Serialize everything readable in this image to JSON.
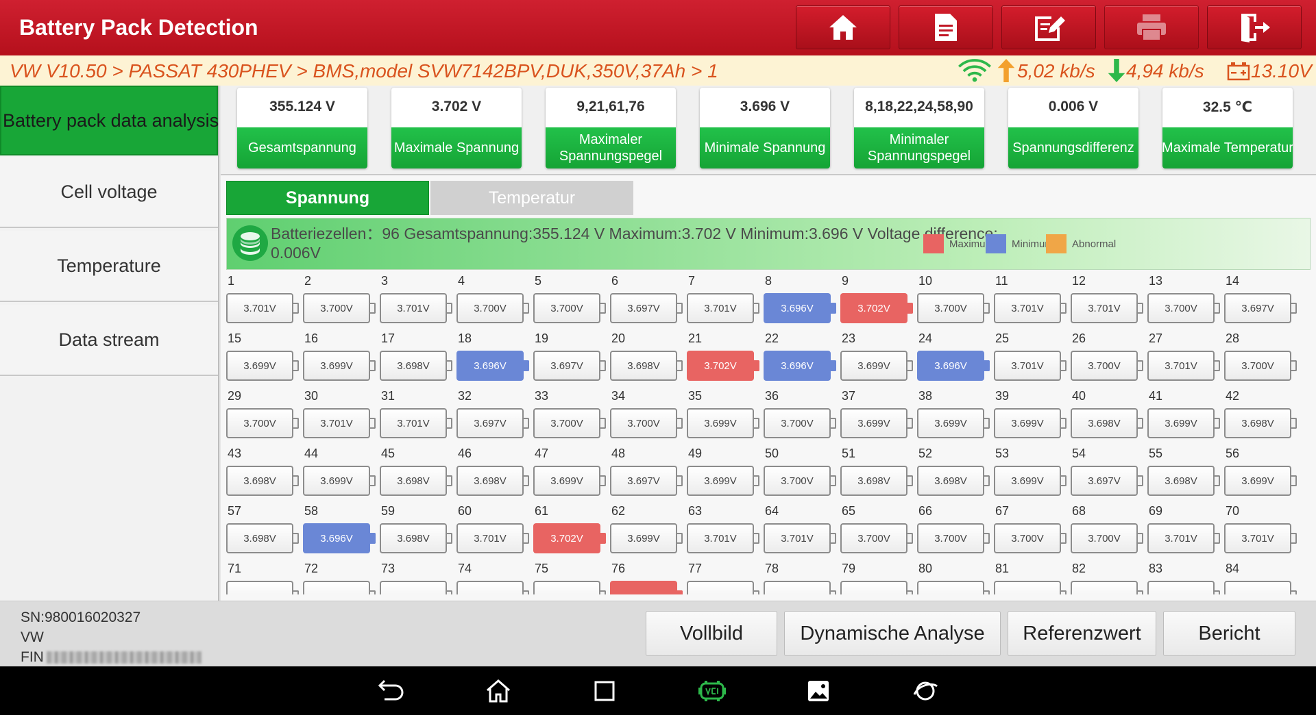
{
  "app": {
    "title": "Battery Pack Detection"
  },
  "toolbar": [
    "home-icon",
    "report-icon",
    "edit-icon",
    "print-icon",
    "exit-icon"
  ],
  "status": {
    "breadcrumb": "VW V10.50 > PASSAT 430PHEV  > BMS,model SVW7142BPV,DUK,350V,37Ah > 1",
    "upload": "5,02 kb/s",
    "download": "4,94 kb/s",
    "battery": "13.10V"
  },
  "sidebar": {
    "items": [
      "Battery pack data analysis",
      "Cell voltage",
      "Temperature",
      "Data stream"
    ]
  },
  "summary": [
    {
      "value": "355.124 V",
      "label": "Gesamtspannung"
    },
    {
      "value": "3.702 V",
      "label": "Maximale Spannung"
    },
    {
      "value": "9,21,61,76",
      "label": "Maximaler\nSpannungspegel"
    },
    {
      "value": "3.696 V",
      "label": "Minimale Spannung"
    },
    {
      "value": "8,18,22,24,58,90",
      "label": "Minimaler\nSpannungspegel"
    },
    {
      "value": "0.006 V",
      "label": "Spannungsdifferenz"
    },
    {
      "value": "32.5 ℃",
      "label": "Maximale Temperatur"
    }
  ],
  "tabs": {
    "spannung": "Spannung",
    "temperatur": "Temperatur"
  },
  "info": {
    "text": "Batteriezellen：96    Gesamtspannung:355.124 V    Maximum:3.702 V    Minimum:3.696 V    Voltage difference: 0.006V",
    "legend": [
      {
        "label": "Maximum",
        "color": "#e86462"
      },
      {
        "label": "Minimum",
        "color": "#6a87d6"
      },
      {
        "label": "Abnormal",
        "color": "#f0a647"
      }
    ]
  },
  "cells": [
    "3.701V",
    "3.700V",
    "3.701V",
    "3.700V",
    "3.700V",
    "3.697V",
    "3.701V",
    "3.696V",
    "3.702V",
    "3.700V",
    "3.701V",
    "3.701V",
    "3.700V",
    "3.697V",
    "3.699V",
    "3.699V",
    "3.698V",
    "3.696V",
    "3.697V",
    "3.698V",
    "3.702V",
    "3.696V",
    "3.699V",
    "3.696V",
    "3.701V",
    "3.700V",
    "3.701V",
    "3.700V",
    "3.700V",
    "3.701V",
    "3.701V",
    "3.697V",
    "3.700V",
    "3.700V",
    "3.699V",
    "3.700V",
    "3.699V",
    "3.699V",
    "3.699V",
    "3.698V",
    "3.699V",
    "3.698V",
    "3.698V",
    "3.699V",
    "3.698V",
    "3.698V",
    "3.699V",
    "3.697V",
    "3.699V",
    "3.700V",
    "3.698V",
    "3.698V",
    "3.699V",
    "3.697V",
    "3.698V",
    "3.699V",
    "3.698V",
    "3.696V",
    "3.698V",
    "3.701V",
    "3.702V",
    "3.699V",
    "3.701V",
    "3.701V",
    "3.700V",
    "3.700V",
    "3.700V",
    "3.700V",
    "3.701V",
    "3.701V",
    "",
    "",
    "",
    "",
    "",
    "",
    "",
    "",
    "",
    "",
    "",
    "",
    "",
    ""
  ],
  "cells_state": {
    "max": [
      9,
      21,
      61,
      76
    ],
    "min": [
      8,
      18,
      22,
      24,
      58
    ]
  },
  "footer": {
    "sn": "SN:980016020327",
    "make": "VW",
    "fin_label": "FIN",
    "buttons": [
      "Vollbild",
      "Dynamische Analyse",
      "Referenzwert",
      "Bericht"
    ]
  },
  "navbar": [
    "back-icon",
    "home-icon",
    "recents-icon",
    "vci-icon",
    "gallery-icon",
    "browser-icon"
  ]
}
